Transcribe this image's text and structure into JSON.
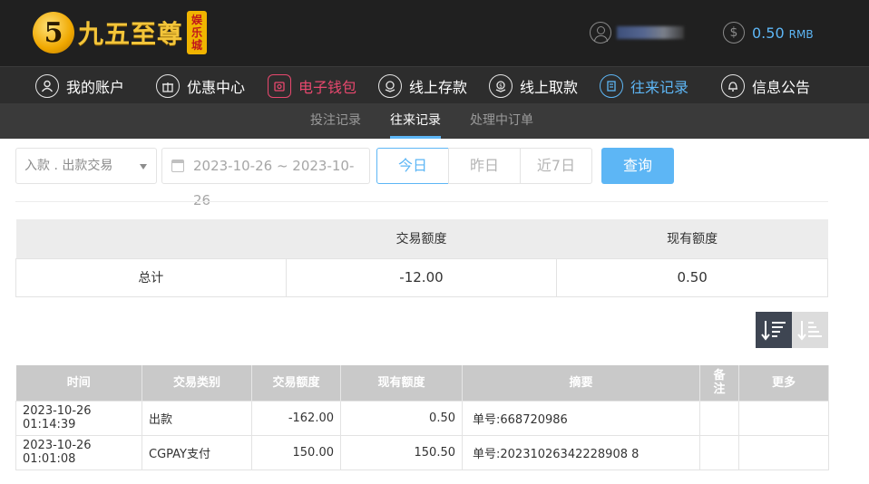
{
  "header": {
    "logo_mark": "5",
    "logo_text": "九五至尊",
    "logo_badge": [
      "娱",
      "乐",
      "城"
    ],
    "balance": "0.50",
    "currency": "RMB"
  },
  "main_nav": [
    {
      "label": "我的账户",
      "icon": "user-icon"
    },
    {
      "label": "优惠中心",
      "icon": "gift-icon"
    },
    {
      "label": "电子钱包",
      "icon": "wallet-icon"
    },
    {
      "label": "线上存款",
      "icon": "deposit-icon"
    },
    {
      "label": "线上取款",
      "icon": "withdraw-icon"
    },
    {
      "label": "往来记录",
      "icon": "record-icon"
    },
    {
      "label": "信息公告",
      "icon": "bell-icon"
    }
  ],
  "sub_nav": [
    "投注记录",
    "往来记录",
    "处理中订单"
  ],
  "filters": {
    "type_select": "入款 . 出款交易",
    "date_range": "2023-10-26 ~ 2023-10-26",
    "quick": [
      "今日",
      "昨日",
      "近7日"
    ],
    "query_label": "查询"
  },
  "summary": {
    "headers": [
      "",
      "交易额度",
      "现有额度"
    ],
    "row": {
      "label": "总计",
      "amount": "-12.00",
      "balance": "0.50"
    }
  },
  "records": {
    "headers": [
      "时间",
      "交易类别",
      "交易额度",
      "现有额度",
      "摘要",
      "备注",
      "更多"
    ],
    "rows": [
      {
        "time": "2023-10-26 01:14:39",
        "type": "出款",
        "amount": "-162.00",
        "balance": "0.50",
        "summary": "单号:668720986",
        "note": "",
        "more": ""
      },
      {
        "time": "2023-10-26 01:01:08",
        "type": "CGPAY支付",
        "amount": "150.00",
        "balance": "150.50",
        "summary": "单号:20231026342228908 8",
        "note": "",
        "more": ""
      }
    ]
  },
  "colors": {
    "accent": "#5db6f5",
    "wallet": "#e8486e",
    "header_bg": "#202020",
    "nav_bg": "#2d2d2d",
    "subnav_bg": "#3a3a3a"
  }
}
